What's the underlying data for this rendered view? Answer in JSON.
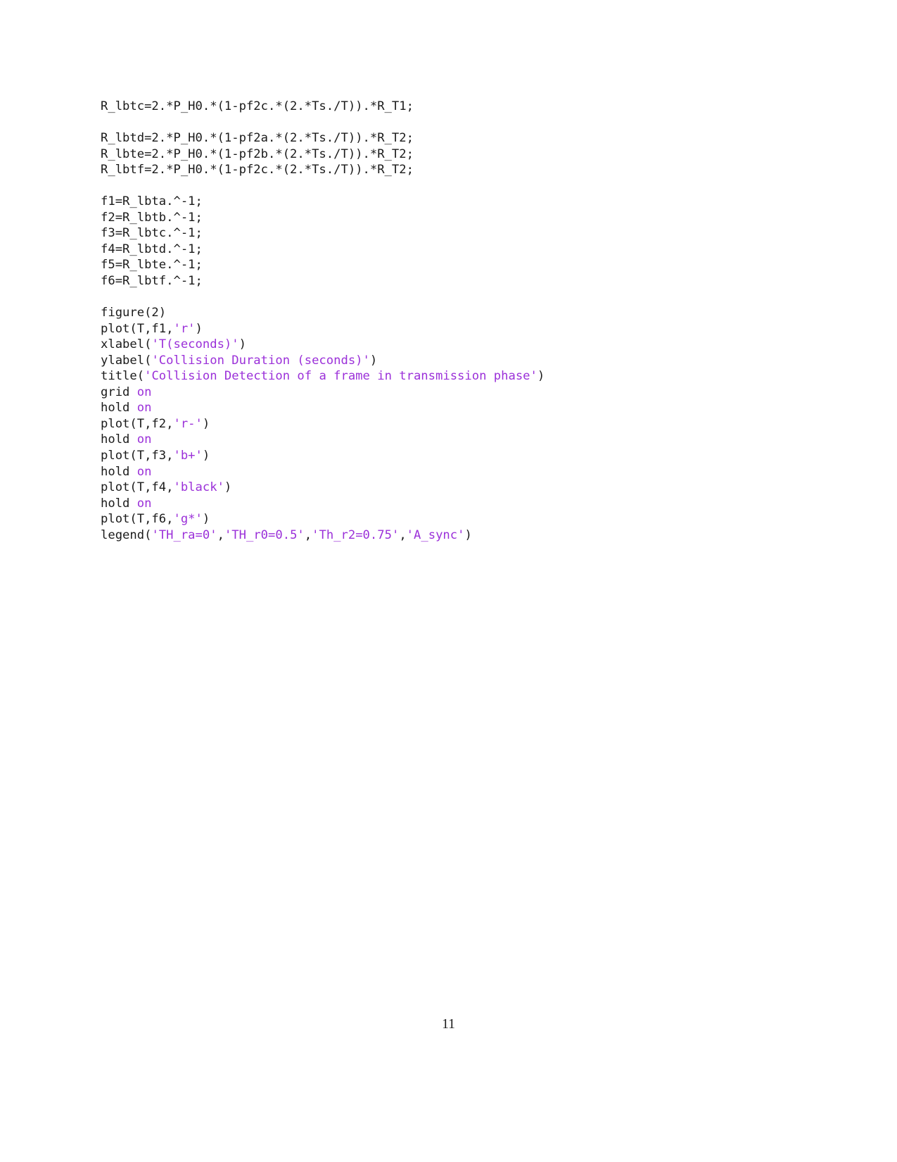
{
  "document": {
    "page_number": "11",
    "colors": {
      "text": "#1a1a1a",
      "string_literal": "#9B30D9",
      "keyword": "#9B30D9",
      "background": "#ffffff"
    }
  },
  "code": {
    "language": "MATLAB",
    "lines": [
      {
        "id": "line-1",
        "tokens": [
          {
            "type": "plain",
            "text": "R_lbtc=2.*P_H0.*(1-pf2c.*(2.*Ts./T)).*R_T1;"
          }
        ]
      },
      {
        "id": "line-2",
        "blank": true,
        "tokens": []
      },
      {
        "id": "line-3",
        "tokens": [
          {
            "type": "plain",
            "text": "R_lbtd=2.*P_H0.*(1-pf2a.*(2.*Ts./T)).*R_T2;"
          }
        ]
      },
      {
        "id": "line-4",
        "tokens": [
          {
            "type": "plain",
            "text": "R_lbte=2.*P_H0.*(1-pf2b.*(2.*Ts./T)).*R_T2;"
          }
        ]
      },
      {
        "id": "line-5",
        "tokens": [
          {
            "type": "plain",
            "text": "R_lbtf=2.*P_H0.*(1-pf2c.*(2.*Ts./T)).*R_T2;"
          }
        ]
      },
      {
        "id": "line-6",
        "blank": true,
        "tokens": []
      },
      {
        "id": "line-7",
        "tokens": [
          {
            "type": "plain",
            "text": "f1=R_lbta.^-1;"
          }
        ]
      },
      {
        "id": "line-8",
        "tokens": [
          {
            "type": "plain",
            "text": "f2=R_lbtb.^-1;"
          }
        ]
      },
      {
        "id": "line-9",
        "tokens": [
          {
            "type": "plain",
            "text": "f3=R_lbtc.^-1;"
          }
        ]
      },
      {
        "id": "line-10",
        "tokens": [
          {
            "type": "plain",
            "text": "f4=R_lbtd.^-1;"
          }
        ]
      },
      {
        "id": "line-11",
        "tokens": [
          {
            "type": "plain",
            "text": "f5=R_lbte.^-1;"
          }
        ]
      },
      {
        "id": "line-12",
        "tokens": [
          {
            "type": "plain",
            "text": "f6=R_lbtf.^-1;"
          }
        ]
      },
      {
        "id": "line-13",
        "blank": true,
        "tokens": []
      },
      {
        "id": "line-14",
        "tokens": [
          {
            "type": "plain",
            "text": "figure(2)"
          }
        ]
      },
      {
        "id": "line-15",
        "tokens": [
          {
            "type": "plain",
            "text": "plot(T,f1,"
          },
          {
            "type": "string",
            "text": "'r'"
          },
          {
            "type": "plain",
            "text": ")"
          }
        ]
      },
      {
        "id": "line-16",
        "tokens": [
          {
            "type": "plain",
            "text": "xlabel("
          },
          {
            "type": "string",
            "text": "'T(seconds)'"
          },
          {
            "type": "plain",
            "text": ")"
          }
        ]
      },
      {
        "id": "line-17",
        "tokens": [
          {
            "type": "plain",
            "text": "ylabel("
          },
          {
            "type": "string",
            "text": "'Collision Duration (seconds)'"
          },
          {
            "type": "plain",
            "text": ")"
          }
        ]
      },
      {
        "id": "line-18",
        "tokens": [
          {
            "type": "plain",
            "text": "title("
          },
          {
            "type": "string",
            "text": "'Collision Detection of a frame in transmission phase'"
          },
          {
            "type": "plain",
            "text": ")"
          }
        ]
      },
      {
        "id": "line-19",
        "tokens": [
          {
            "type": "plain",
            "text": "grid "
          },
          {
            "type": "keyword",
            "text": "on"
          }
        ]
      },
      {
        "id": "line-20",
        "tokens": [
          {
            "type": "plain",
            "text": "hold "
          },
          {
            "type": "keyword",
            "text": "on"
          }
        ]
      },
      {
        "id": "line-21",
        "tokens": [
          {
            "type": "plain",
            "text": "plot(T,f2,"
          },
          {
            "type": "string",
            "text": "'r-'"
          },
          {
            "type": "plain",
            "text": ")"
          }
        ]
      },
      {
        "id": "line-22",
        "tokens": [
          {
            "type": "plain",
            "text": "hold "
          },
          {
            "type": "keyword",
            "text": "on"
          }
        ]
      },
      {
        "id": "line-23",
        "tokens": [
          {
            "type": "plain",
            "text": "plot(T,f3,"
          },
          {
            "type": "string",
            "text": "'b+'"
          },
          {
            "type": "plain",
            "text": ")"
          }
        ]
      },
      {
        "id": "line-24",
        "tokens": [
          {
            "type": "plain",
            "text": "hold "
          },
          {
            "type": "keyword",
            "text": "on"
          }
        ]
      },
      {
        "id": "line-25",
        "tokens": [
          {
            "type": "plain",
            "text": "plot(T,f4,"
          },
          {
            "type": "string",
            "text": "'black'"
          },
          {
            "type": "plain",
            "text": ")"
          }
        ]
      },
      {
        "id": "line-26",
        "tokens": [
          {
            "type": "plain",
            "text": "hold "
          },
          {
            "type": "keyword",
            "text": "on"
          }
        ]
      },
      {
        "id": "line-27",
        "tokens": [
          {
            "type": "plain",
            "text": "plot(T,f6,"
          },
          {
            "type": "string",
            "text": "'g*'"
          },
          {
            "type": "plain",
            "text": ")"
          }
        ]
      },
      {
        "id": "line-28",
        "tokens": [
          {
            "type": "plain",
            "text": "legend("
          },
          {
            "type": "string",
            "text": "'TH_ra=0'"
          },
          {
            "type": "plain",
            "text": ","
          },
          {
            "type": "string",
            "text": "'TH_r0=0.5'"
          },
          {
            "type": "plain",
            "text": ","
          },
          {
            "type": "string",
            "text": "'Th_r2=0.75'"
          },
          {
            "type": "plain",
            "text": ","
          },
          {
            "type": "string",
            "text": "'A_sync'"
          },
          {
            "type": "plain",
            "text": ")"
          }
        ]
      }
    ]
  }
}
